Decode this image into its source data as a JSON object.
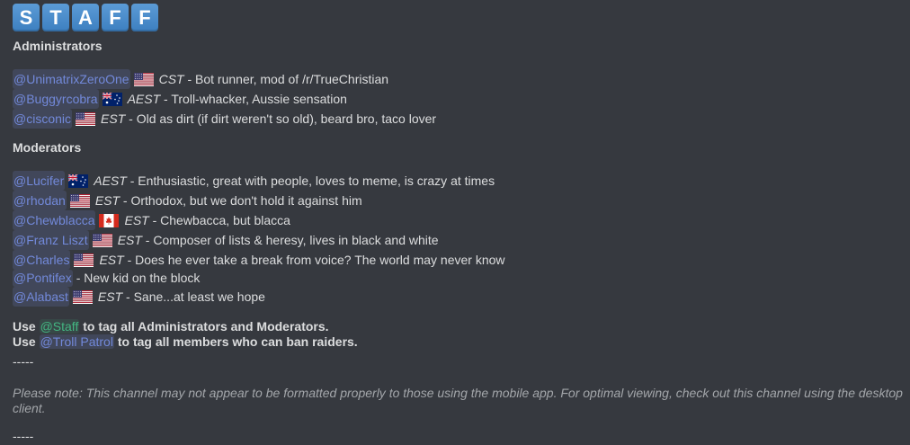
{
  "banner": {
    "letters": [
      "S",
      "T",
      "A",
      "F",
      "F"
    ]
  },
  "sections": [
    {
      "title": "Administrators",
      "members": [
        {
          "mention": "@UnimatrixZeroOne",
          "flag": "us",
          "tz": "CST",
          "desc": " - Bot runner, mod of /r/TrueChristian"
        },
        {
          "mention": "@Buggyrcobra",
          "flag": "au",
          "tz": "AEST",
          "desc": " - Troll-whacker, Aussie sensation"
        },
        {
          "mention": "@cisconic",
          "flag": "us",
          "tz": "EST",
          "desc": " - Old as dirt (if dirt weren't so old), beard bro, taco lover"
        }
      ]
    },
    {
      "title": "Moderators",
      "members": [
        {
          "mention": "@Lucifer",
          "flag": "au",
          "tz": "AEST",
          "desc": " - Enthusiastic, great with people, loves to meme, is crazy at times"
        },
        {
          "mention": "@rhodan",
          "flag": "us",
          "tz": "EST",
          "desc": " - Orthodox, but we don't hold it against him"
        },
        {
          "mention": "@Chewblacca",
          "flag": "ca",
          "tz": "EST",
          "desc": " - Chewbacca, but blacca"
        },
        {
          "mention": "@Franz Liszt",
          "flag": "us",
          "tz": "EST",
          "desc": " - Composer of lists & heresy, lives in black and white"
        },
        {
          "mention": "@Charles",
          "flag": "us",
          "tz": "EST",
          "desc": " - Does he ever take a break from voice? The world may never know"
        },
        {
          "mention": "@Pontifex",
          "flag": "",
          "tz": "",
          "desc": " - New kid on the block"
        },
        {
          "mention": "@Alabast",
          "flag": "us",
          "tz": "EST",
          "desc": " - Sane...at least we hope"
        }
      ]
    }
  ],
  "usage": [
    {
      "pre": "Use ",
      "mention": "@Staff",
      "color": "green",
      "post": " to tag all Administrators and Moderators."
    },
    {
      "pre": "Use ",
      "mention": "@Troll Patrol",
      "color": "blue",
      "post": " to tag all members who can ban raiders."
    }
  ],
  "separator": "-----",
  "note": "Please note: This channel may not appear to be formatted properly to those using the mobile app. For optimal viewing, check out this channel using the desktop client.",
  "colors": {
    "background": "#36393f",
    "text": "#dcddde",
    "mention": "#7289da",
    "mention_green": "#43b581",
    "tile": "#4a8bca"
  }
}
